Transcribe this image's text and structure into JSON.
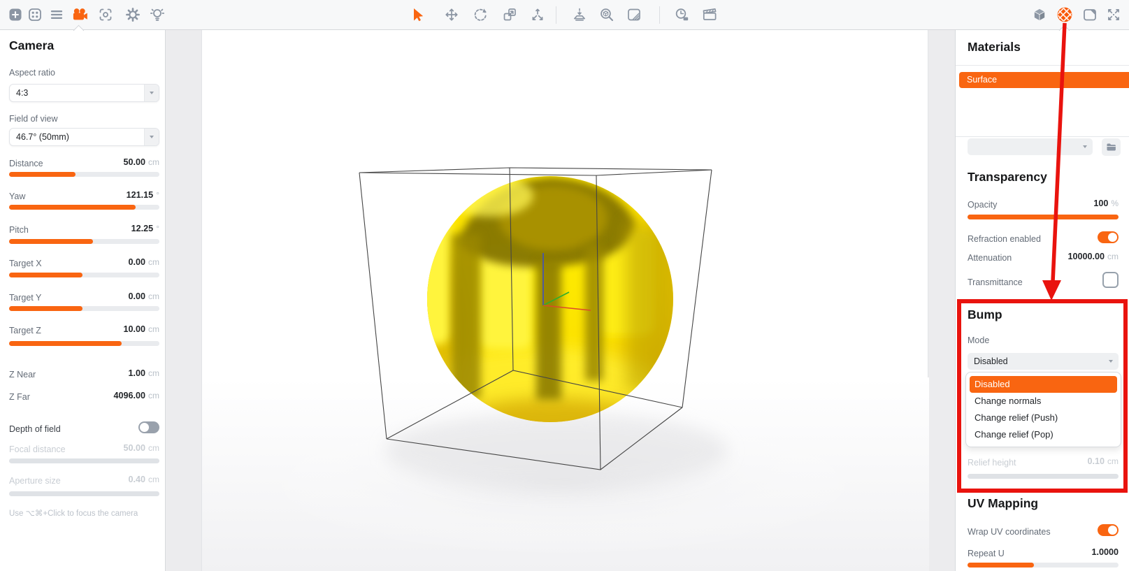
{
  "colors": {
    "accent": "#f96511",
    "annotation_red": "#e9130e",
    "icon_gray": "#8b95a3",
    "sphere_yellow": "#fbdf00"
  },
  "toolbar": {
    "left_icons": [
      "add-object",
      "library",
      "object-list",
      "camera",
      "focus",
      "settings-gear",
      "lighting"
    ],
    "active_left_icon": "camera",
    "center_icons": [
      "select-cursor",
      "move",
      "rotate",
      "scale",
      "spread-apart",
      "drop-to-floor",
      "zoom-to-object",
      "texture",
      "time",
      "clapperboard"
    ],
    "active_center_icon": "select-cursor",
    "right_icons": [
      "geometry-cube",
      "materials-sphere",
      "snapshot",
      "expand"
    ],
    "active_right_icon": "materials-sphere"
  },
  "camera_panel": {
    "title": "Camera",
    "aspect_ratio": {
      "label": "Aspect ratio",
      "value": "4:3"
    },
    "field_of_view": {
      "label": "Field of view",
      "value": "46.7° (50mm)"
    },
    "sliders": [
      {
        "label": "Distance",
        "value": "50.00",
        "unit": "cm",
        "fill": 44
      },
      {
        "label": "Yaw",
        "value": "121.15",
        "unit": "°",
        "fill": 84
      },
      {
        "label": "Pitch",
        "value": "12.25",
        "unit": "°",
        "fill": 56
      },
      {
        "label": "Target X",
        "value": "0.00",
        "unit": "cm",
        "fill": 49
      },
      {
        "label": "Target Y",
        "value": "0.00",
        "unit": "cm",
        "fill": 49
      },
      {
        "label": "Target Z",
        "value": "10.00",
        "unit": "cm",
        "fill": 75
      }
    ],
    "readouts": [
      {
        "label": "Z Near",
        "value": "1.00",
        "unit": "cm"
      },
      {
        "label": "Z Far",
        "value": "4096.00",
        "unit": "cm"
      }
    ],
    "depth_of_field": {
      "label": "Depth of field",
      "enabled": false
    },
    "disabled_sliders": [
      {
        "label": "Focal distance",
        "value": "50.00",
        "unit": "cm"
      },
      {
        "label": "Aperture size",
        "value": "0.40",
        "unit": "cm"
      }
    ],
    "hint": "Use ⌥⌘+Click to focus the camera"
  },
  "materials_panel": {
    "title": "Materials",
    "materials": [
      {
        "name": "Surface",
        "selected": true
      }
    ],
    "transparency": {
      "title": "Transparency",
      "opacity": {
        "label": "Opacity",
        "value": "100",
        "unit": "%",
        "fill": 100
      },
      "refraction": {
        "label": "Refraction enabled",
        "enabled": true
      },
      "attenuation": {
        "label": "Attenuation",
        "value": "10000.00",
        "unit": "cm"
      },
      "transmittance": {
        "label": "Transmittance",
        "checked": false
      }
    },
    "bump": {
      "title": "Bump",
      "mode_label": "Mode",
      "mode_value": "Disabled",
      "menu_options": [
        {
          "label": "Disabled",
          "selected": true
        },
        {
          "label": "Change normals",
          "selected": false
        },
        {
          "label": "Change relief (Push)",
          "selected": false
        },
        {
          "label": "Change relief (Pop)",
          "selected": false
        }
      ],
      "relief_height": {
        "label": "Relief height",
        "value": "0.10",
        "unit": "cm"
      }
    },
    "uv_mapping": {
      "title": "UV Mapping",
      "wrap": {
        "label": "Wrap UV coordinates",
        "enabled": true
      },
      "repeat_u": {
        "label": "Repeat U",
        "value": "1.0000",
        "fill": 44
      }
    }
  },
  "viewport": {
    "scene": "glossy yellow sphere inside wireframe cube with xyz axis gizmo"
  },
  "annotation": {
    "type": "arrow-and-box",
    "target": "bump-section"
  }
}
